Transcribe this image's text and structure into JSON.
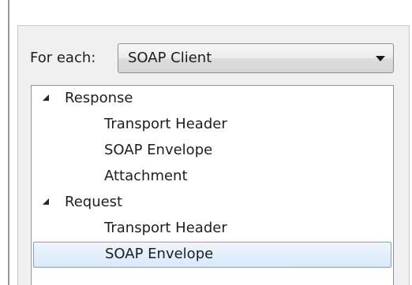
{
  "for_each": {
    "label": "For each:",
    "selected_value": "SOAP Client"
  },
  "tree": {
    "nodes": [
      {
        "label": "Response",
        "expanded": true,
        "children": [
          "Transport Header",
          "SOAP Envelope",
          "Attachment"
        ]
      },
      {
        "label": "Request",
        "expanded": true,
        "children": [
          "Transport Header",
          "SOAP Envelope"
        ]
      }
    ],
    "selected": "Request / SOAP Envelope"
  },
  "colors": {
    "selection_border": "#7da2ce",
    "selection_fill": "#d9e8fb",
    "panel_background": "#f0f0f0"
  }
}
